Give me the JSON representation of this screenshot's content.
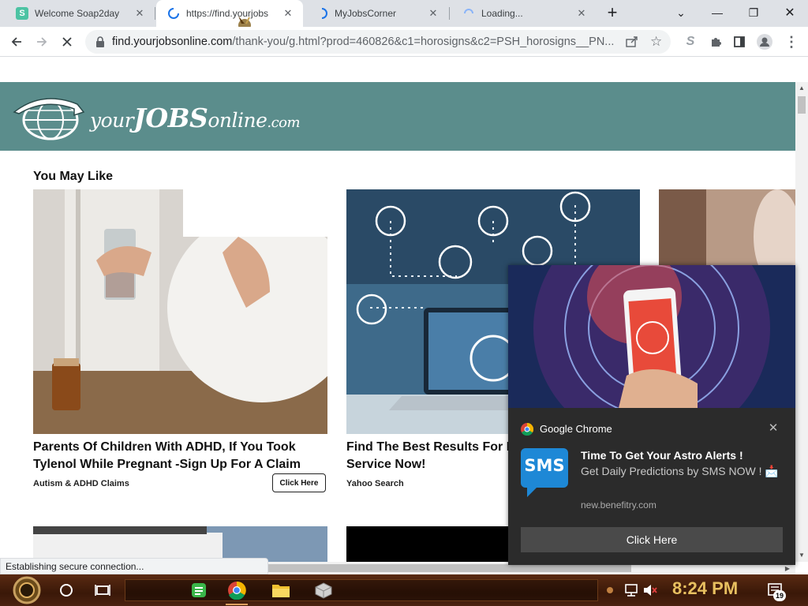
{
  "tabs": [
    {
      "title": "Welcome Soap2day",
      "favicon_letter": "S"
    },
    {
      "title": "https://find.yourjobs",
      "active": true
    },
    {
      "title": "MyJobsCorner"
    },
    {
      "title": "Loading..."
    }
  ],
  "toolbar": {
    "url_host": "find.yourjobsonline.com",
    "url_rest": "/thank-you/g.html?prod=460826&c1=horosigns&c2=PSH_horosigns__PN..."
  },
  "page": {
    "logo": {
      "part1": "your",
      "part2": "JOBS",
      "part3": "online",
      "part4": ".com"
    },
    "section_title": "You May Like",
    "cards": [
      {
        "title": "Parents Of Children With ADHD, If You Took Tylenol While Pregnant -Sign Up For A Claim",
        "source": "Autism & ADHD Claims",
        "button": "Click Here"
      },
      {
        "title": "Find The Best Results For I Service Now!",
        "source": "Yahoo Search"
      }
    ]
  },
  "status_text": "Establishing secure connection...",
  "notification": {
    "app": "Google Chrome",
    "icon_text": "SMS",
    "title": "Time To Get Your Astro Alerts !",
    "body": "Get Daily Predictions by SMS NOW ! 📩",
    "domain": "new.benefitry.com",
    "button": "Click Here"
  },
  "taskbar": {
    "time": "8:24 PM",
    "notification_count": "19"
  },
  "colors": {
    "banner": "#5b8d8c",
    "notification_bg": "#2b2b2b",
    "sms_icon": "#1e88d6"
  }
}
